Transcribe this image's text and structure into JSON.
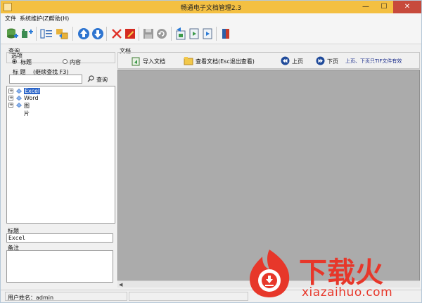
{
  "window": {
    "title": "畅通电子文档管理2.3",
    "minimize_glyph": "—",
    "maximize_glyph": "☐",
    "close_glyph": "✕"
  },
  "menu": {
    "file": "文件",
    "system": "系统维护(Z)",
    "help": "帮助(H)"
  },
  "toolbar": {
    "icons": [
      "add-database-icon",
      "add-node-icon",
      "indent-icon",
      "move-icon",
      "up-arrow-icon",
      "down-arrow-icon",
      "delete-icon",
      "flag-icon",
      "save-icon",
      "undo-icon",
      "import-icon",
      "export-icon",
      "export2-icon",
      "book-icon"
    ]
  },
  "left": {
    "query_label": "查询",
    "options_label": "选项",
    "option_title": "标题",
    "option_content": "内容",
    "selected_option": "标题",
    "search_label": "标 题",
    "search_hint": "(继续查找 F3)",
    "search_value": "",
    "query_button": "查询",
    "tree": [
      {
        "label": "Excel",
        "selected": true
      },
      {
        "label": "Word",
        "selected": false
      },
      {
        "label": "图片",
        "selected": false
      }
    ],
    "title_field_label": "标题",
    "title_field_value": "Excel",
    "remarks_label": "备注",
    "remarks_value": ""
  },
  "right": {
    "doc_label": "文档",
    "import_button": "导入文档",
    "view_button": "查看文档(Esc退出查看)",
    "prev_button": "上页",
    "next_button": "下页",
    "hint": "上页、下页只TIF文件有效"
  },
  "status": {
    "user": "用户姓名：admin"
  },
  "watermark": {
    "title": "下载火",
    "url": "xiazaihuo.com"
  },
  "colors": {
    "titlebar": "#f4c042",
    "close": "#c74a3c",
    "selection": "#2a64c8",
    "doc_background": "#ababab",
    "watermark": "#e7372a"
  }
}
